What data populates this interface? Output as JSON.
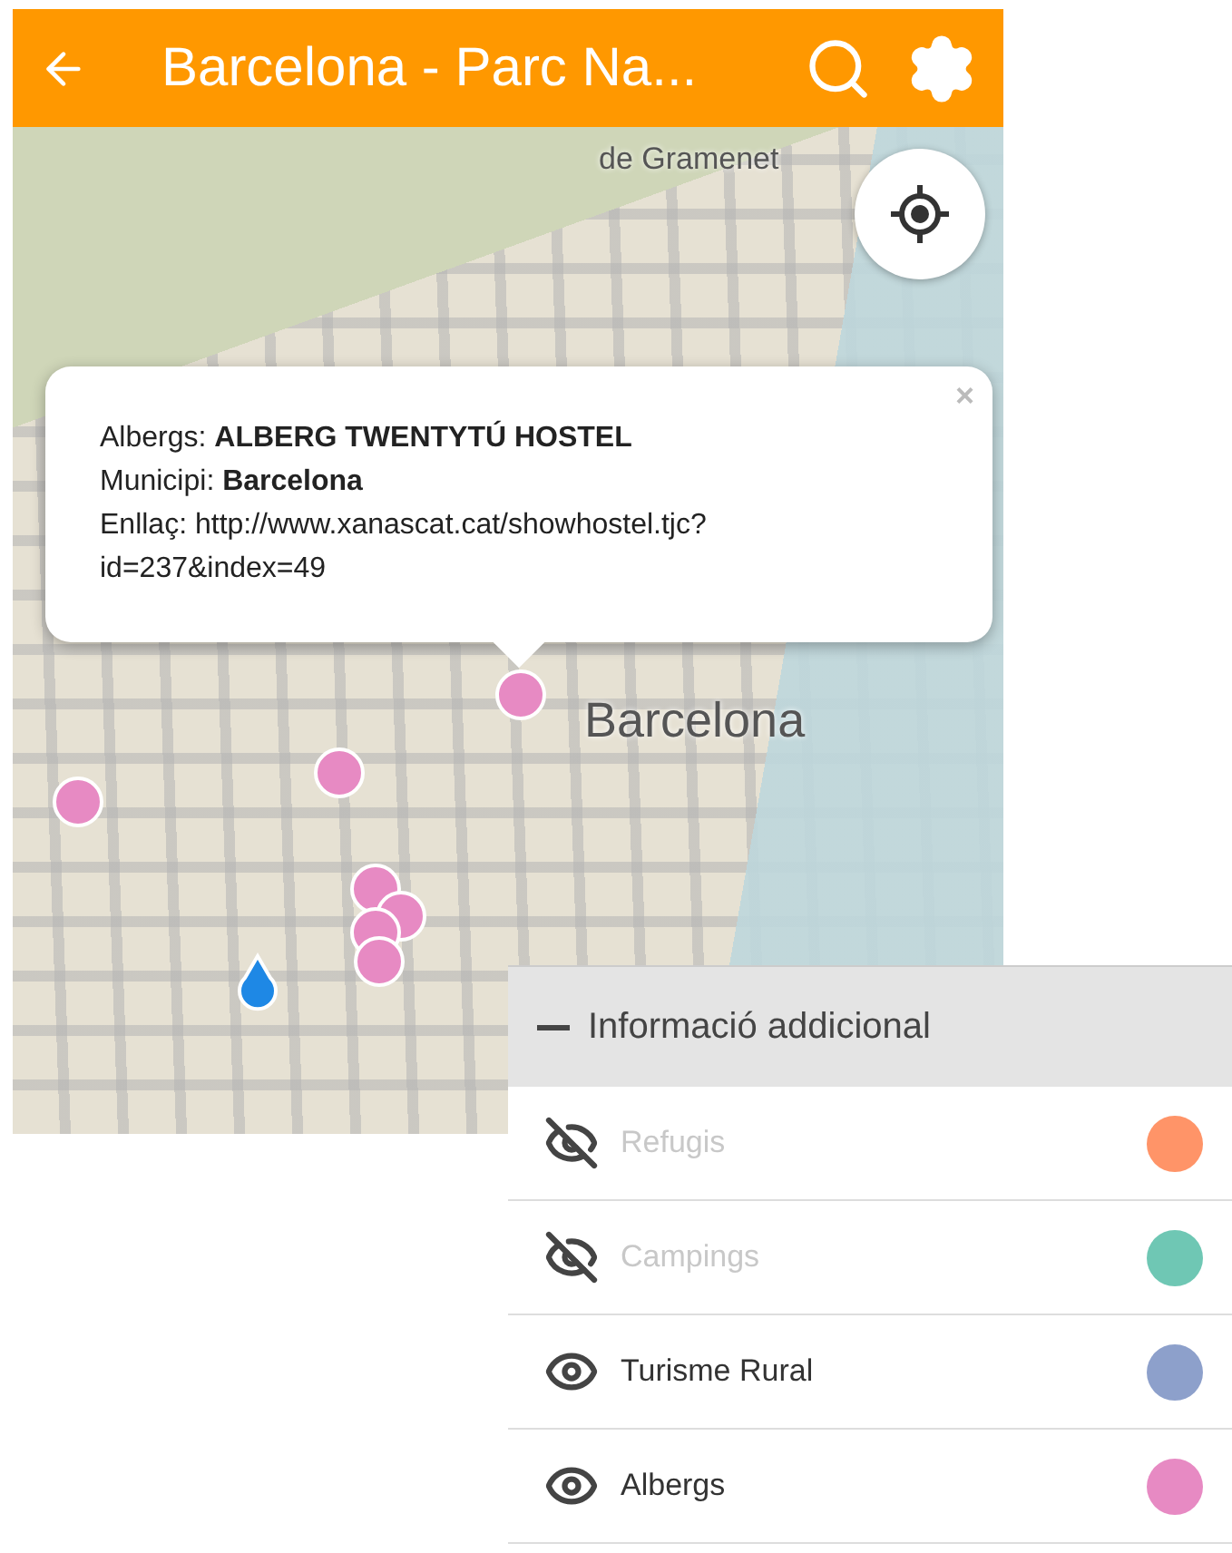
{
  "app_bar": {
    "title": "Barcelona - Parc Na..."
  },
  "map": {
    "labels": [
      "de Gramenet",
      "Barcelona"
    ]
  },
  "popup": {
    "close": "×",
    "lines": [
      "Albergs: **ALBERG TWENTYTÚ HOSTEL**",
      "Municipi: **Barcelona**",
      "Enllaç: http://www.xanascat.cat/showhostel.tjc?id=237&index=49"
    ]
  },
  "layers_panel": {
    "title": "Informació addicional",
    "expanded": true,
    "layers": [
      {
        "name": "Refugis",
        "visible": false,
        "color": "#ff9468"
      },
      {
        "name": "Campings",
        "visible": false,
        "color": "#6fc7b4"
      },
      {
        "name": "Turisme Rural",
        "visible": true,
        "color": "#8da0cb"
      },
      {
        "name": "Albergs",
        "visible": true,
        "color": "#e78ac3"
      }
    ]
  }
}
